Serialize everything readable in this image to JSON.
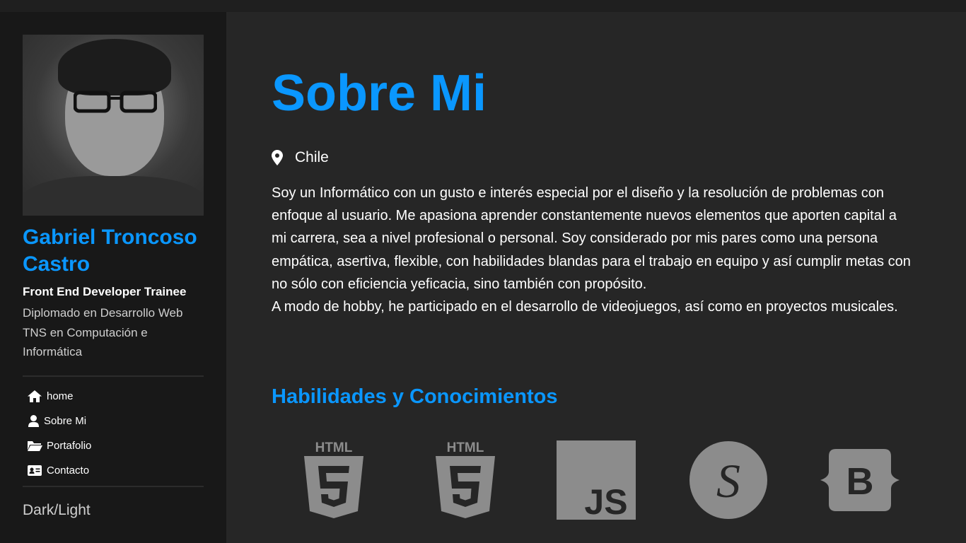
{
  "profile": {
    "name": "Gabriel Troncoso Castro",
    "role": "Front End Developer Trainee",
    "desc_line1": "Diplomado en Desarrollo Web",
    "desc_line2": "TNS en Computación e Informática"
  },
  "nav": {
    "items": [
      {
        "label": "home",
        "icon": "home-icon"
      },
      {
        "label": "Sobre Mi",
        "icon": "user-icon"
      },
      {
        "label": "Portafolio",
        "icon": "folder-open-icon"
      },
      {
        "label": "Contacto",
        "icon": "contact-card-icon"
      }
    ]
  },
  "theme_toggle": "Dark/Light",
  "main": {
    "title": "Sobre Mi",
    "location": "Chile",
    "about_p1": "Soy un Informático con un gusto e interés especial por el diseño y la resolución de problemas con enfoque al usuario. Me apasiona aprender constantemente nuevos elementos que aporten capital a mi carrera, sea a nivel profesional o personal. Soy considerado por mis pares como una persona empática, asertiva, flexible, con habilidades blandas para el trabajo en equipo y así cumplir metas con no sólo con eficiencia yeficacia, sino también con propósito.",
    "about_p2": "A modo de hobby, he participado en el desarrollo de videojuegos, así como en proyectos musicales.",
    "skills_title": "Habilidades y Conocimientos",
    "skills": [
      {
        "name": "HTML",
        "icon": "html5-icon"
      },
      {
        "name": "HTML",
        "icon": "html5-icon"
      },
      {
        "name": "JS",
        "icon": "javascript-icon"
      },
      {
        "name": "S",
        "icon": "sass-icon"
      },
      {
        "name": "B",
        "icon": "bootstrap-icon"
      }
    ]
  },
  "colors": {
    "accent": "#0a97ff",
    "sidebar_bg": "#181818",
    "main_bg": "#262626",
    "icon_gray": "#8c8c8c"
  }
}
